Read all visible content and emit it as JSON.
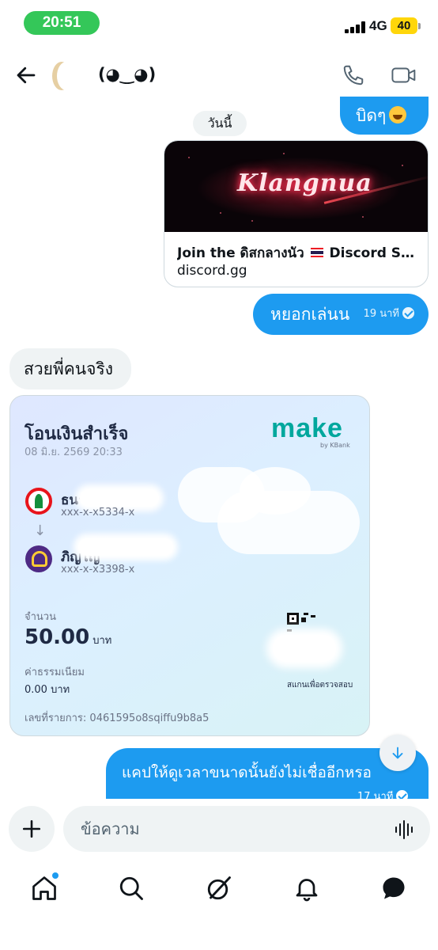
{
  "status_bar": {
    "time": "20:51",
    "network": "4G",
    "battery": "40"
  },
  "header": {
    "contact_name": "(◕‿◕)"
  },
  "chat": {
    "date_divider": "วันนี้",
    "messages": [
      {
        "direction": "out",
        "text": "บิดๆ"
      },
      {
        "direction": "out",
        "type": "link_preview",
        "image_text": "Klangnua",
        "title_prefix": "Join the ดิสกลางนัว",
        "title_suffix": "Discord Se…",
        "domain": "discord.gg"
      },
      {
        "direction": "out",
        "text": "หยอกเล่นน",
        "time": "19 นาที"
      },
      {
        "direction": "in",
        "text": "สวยพี่คนจริง"
      },
      {
        "direction": "in",
        "type": "transfer_slip",
        "title": "โอนเงินสำเร็จ",
        "datetime": "08 มิ.ย. 2569 20:33",
        "brand": "make",
        "brand_sub": "by KBank",
        "from_name": "ธนาคารกสิกร",
        "from_account": "xxx-x-x5334-x",
        "to_name": "ภิญโญ",
        "to_account": "xxx-x-x3398-x",
        "amount_label": "จำนวน",
        "amount": "50.00",
        "currency": "บาท",
        "fee_label": "ค่าธรรมเนียม",
        "fee": "0.00 บาท",
        "ref": "เลขที่รายการ: 0461595o8sqiffu9b8a5",
        "qr_caption": "สแกนเพื่อตรวจสอบ"
      },
      {
        "direction": "out",
        "text": "แคปให้ดูเวลาขนาดนั้นยังไม่เชื่ออีกหรอ",
        "time": "17 นาที"
      }
    ]
  },
  "composer": {
    "placeholder": "ข้อความ"
  },
  "colors": {
    "accent": "#1d9bf0",
    "incoming_bubble": "#eff3f4",
    "status_green": "#34c759",
    "battery_yellow": "#ffd60a"
  },
  "nav": {
    "items": [
      "home-icon",
      "search-icon",
      "grok-icon",
      "bell-icon",
      "messages-icon"
    ]
  }
}
